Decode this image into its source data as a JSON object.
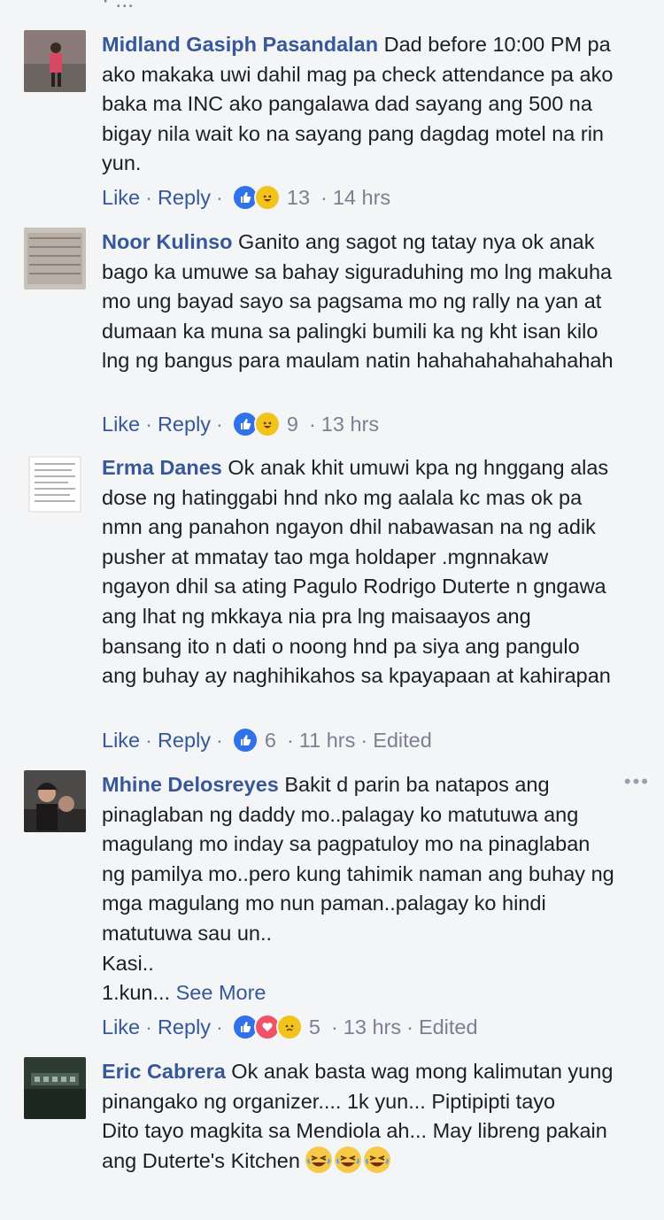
{
  "top_partial": "· ...",
  "comments": [
    {
      "author": "Midland Gasiph Pasandalan",
      "text": " Dad before 10:00 PM pa ako makaka uwi dahil mag pa check attendance pa ako baka ma INC ako pangalawa dad sayang ang 500 na bigay nila wait ko na sayang pang dagdag motel na rin yun.",
      "like_label": "Like",
      "reply_label": "Reply",
      "reactions": [
        "like",
        "haha"
      ],
      "count": "13",
      "time": "14 hrs"
    },
    {
      "author": "Noor Kulinso",
      "text": " Ganito ang sagot ng tatay nya ok anak bago ka umuwe sa bahay siguraduhing mo lng makuha mo ung bayad sayo sa pagsama mo ng rally na yan at dumaan ka muna sa palingki bumili ka ng kht isan kilo lng ng bangus para maulam natin hahahahahahahahah",
      "like_label": "Like",
      "reply_label": "Reply",
      "reactions": [
        "like",
        "haha"
      ],
      "count": "9",
      "time": "13 hrs"
    },
    {
      "author": "Erma Danes",
      "text": " Ok anak khit umuwi kpa ng hnggang alas dose ng hatinggabi hnd nko mg aalala kc mas ok pa nmn ang panahon ngayon dhil nabawasan na ng adik pusher at mmatay tao mga holdaper .mgnnakaw ngayon dhil sa ating Pagulo Rodrigo Duterte n gngawa ang lhat ng mkkaya nia pra lng maisaayos ang bansang ito n dati o noong hnd pa siya ang pangulo ang buhay ay naghihikahos sa kpayapaan at kahirapan",
      "like_label": "Like",
      "reply_label": "Reply",
      "reactions": [
        "like"
      ],
      "count": "6",
      "time": "11 hrs",
      "edited": "Edited"
    },
    {
      "author": "Mhine Delosreyes",
      "text": " Bakit d parin ba natapos ang pinaglaban ng daddy mo..palagay ko matutuwa ang magulang mo inday sa pagpatuloy mo na pinaglaban ng pamilya mo..pero kung tahimik naman ang buhay ng mga magulang mo nun paman..palagay ko hindi matutuwa sau un..\nKasi..\n1.kun...",
      "see_more": " See More",
      "like_label": "Like",
      "reply_label": "Reply",
      "reactions": [
        "like",
        "love",
        "sad"
      ],
      "count": "5",
      "time": "13 hrs",
      "edited": "Edited",
      "more_icon": "•••"
    },
    {
      "author": "Eric Cabrera",
      "text": " Ok anak basta wag mong kalimutan yung pinangako ng organizer.... 1k yun... Piptipipti tayo\nDito tayo magkita sa Mendiola ah... May libreng pakain ang Duterte's Kitchen ",
      "emoji_count": 3
    }
  ],
  "colors": {
    "background": "#f4f5f7",
    "link": "#365899",
    "meta": "#7a8190",
    "like": "#2f72ea"
  }
}
